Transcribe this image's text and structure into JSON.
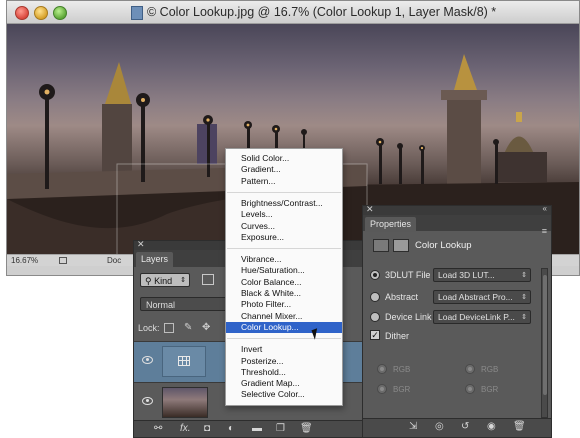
{
  "window": {
    "title": "© Color Lookup.jpg @ 16.7% (Color Lookup 1, Layer Mask/8) *",
    "zoom": "16.67%",
    "doc_label": "Doc"
  },
  "context_menu": {
    "groups": [
      [
        "Solid Color...",
        "Gradient...",
        "Pattern..."
      ],
      [
        "Brightness/Contrast...",
        "Levels...",
        "Curves...",
        "Exposure..."
      ],
      [
        "Vibrance...",
        "Hue/Saturation...",
        "Color Balance...",
        "Black & White...",
        "Photo Filter...",
        "Channel Mixer...",
        "Color Lookup..."
      ],
      [
        "Invert",
        "Posterize...",
        "Threshold...",
        "Gradient Map...",
        "Selective Color..."
      ]
    ],
    "highlighted": "Color Lookup..."
  },
  "layers_panel": {
    "tab": "Layers",
    "kind": "Kind",
    "blend_mode": "Normal",
    "lock_label": "Lock:",
    "bottom_icons": [
      "link-icon",
      "fx-icon",
      "mask-icon",
      "adjustment-icon",
      "folder-icon",
      "new-layer-icon",
      "trash-icon"
    ],
    "fx_label": "fx."
  },
  "properties_panel": {
    "tab": "Properties",
    "title": "Color Lookup",
    "rows": [
      {
        "label": "3DLUT File",
        "value": "Load 3D LUT...",
        "selected": true
      },
      {
        "label": "Abstract",
        "value": "Load Abstract Pro...",
        "selected": false
      },
      {
        "label": "Device Link",
        "value": "Load DeviceLink P...",
        "selected": false
      }
    ],
    "dither_label": "Dither",
    "dither_checked": true,
    "rgb_left": "RGB",
    "rgb_right": "RGB",
    "bgr_left": "BGR",
    "bgr_right": "BGR"
  }
}
